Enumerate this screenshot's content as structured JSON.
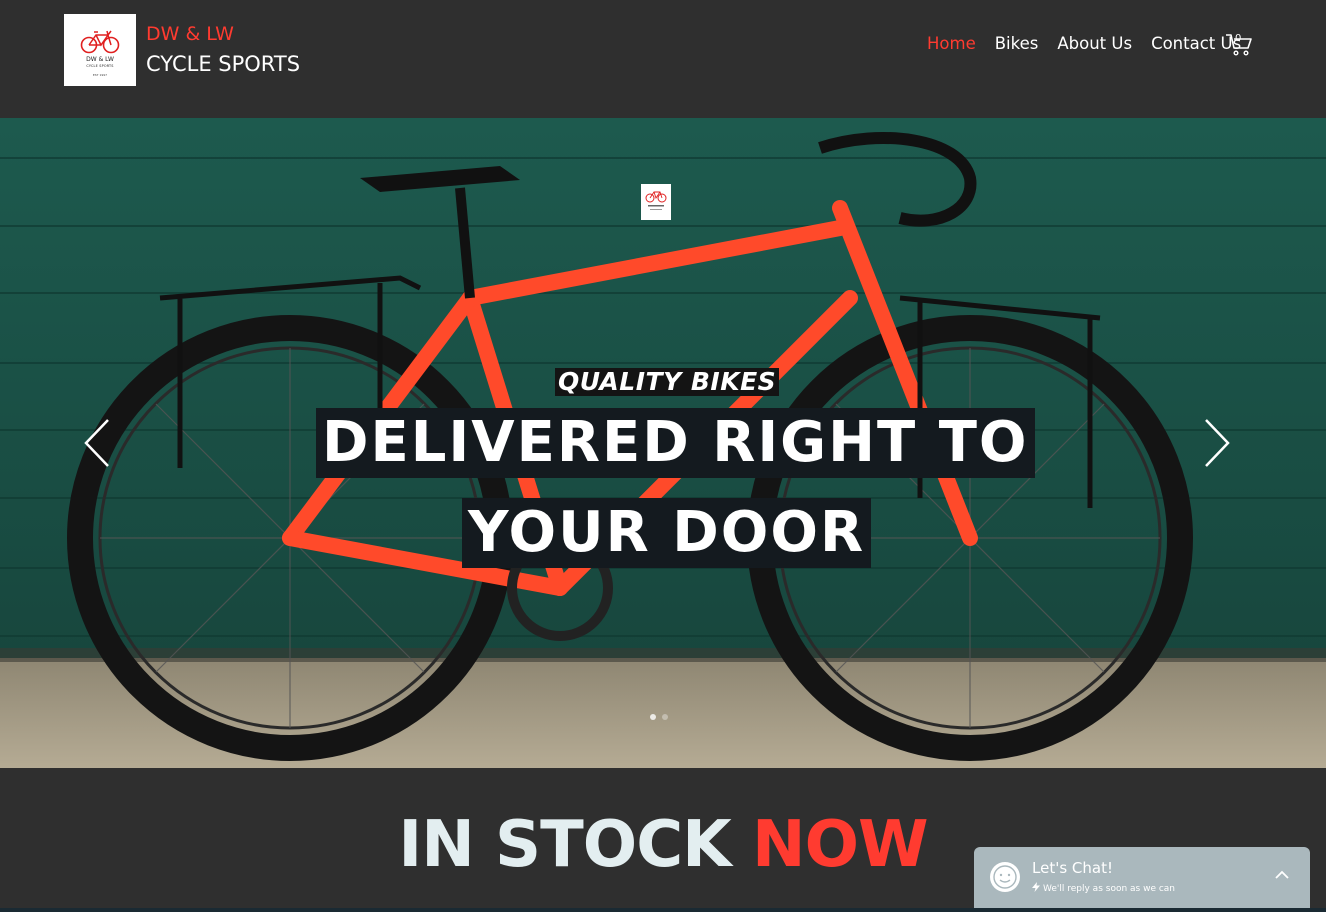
{
  "header": {
    "logo_text_1": "DW & LW",
    "logo_text_2": "CYCLE SPORTS",
    "logo_text_3": "EST 1997",
    "brand_line_1": "DW & LW",
    "brand_line_2": "CYCLE SPORTS"
  },
  "nav": {
    "items": [
      {
        "label": "Home",
        "active": true
      },
      {
        "label": "Bikes",
        "active": false
      },
      {
        "label": "About Us",
        "active": false
      },
      {
        "label": "Contact Us",
        "active": false
      }
    ],
    "cart_count": "0"
  },
  "hero": {
    "kicker": "QUALITY BIKES",
    "headline_line_1": "DELIVERED RIGHT TO",
    "headline_line_2": "YOUR DOOR",
    "slide_dots": 2,
    "active_slide": 1
  },
  "section": {
    "title_part_1": "IN STOCK ",
    "title_part_2": "NOW"
  },
  "chat": {
    "title": "Let's Chat!",
    "subtitle": "We'll reply as soon as we can"
  },
  "colors": {
    "accent": "#ff3b30",
    "background": "#2f2f2f",
    "hero_wall": "#1e4d43",
    "chat_bg": "#aab8bd"
  }
}
